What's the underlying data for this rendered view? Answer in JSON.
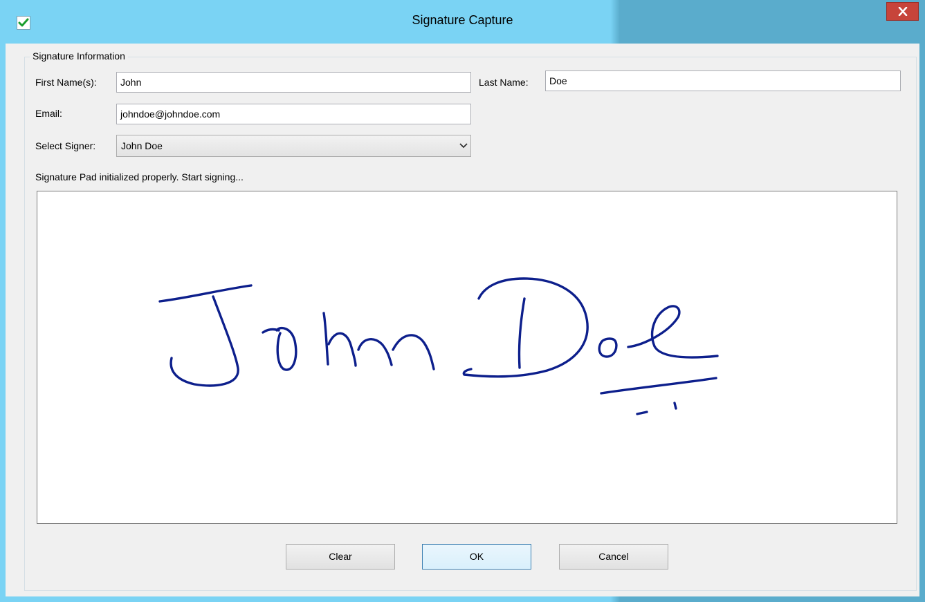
{
  "window": {
    "title": "Signature Capture",
    "icon": "check-icon",
    "close_icon": "close-icon",
    "accent_color": "#7ad3f4",
    "close_color": "#c7443a"
  },
  "group": {
    "title": "Signature Information"
  },
  "form": {
    "first_name_label": "First Name(s):",
    "first_name_value": "John",
    "last_name_label": "Last Name:",
    "last_name_value": "Doe",
    "email_label": "Email:",
    "email_value": "johndoe@johndoe.com",
    "signer_label": "Select Signer:",
    "signer_value": "John Doe"
  },
  "status": {
    "message": "Signature Pad initialized properly. Start signing..."
  },
  "signature": {
    "ink_color": "#0d1f8c"
  },
  "buttons": {
    "clear_label": "Clear",
    "ok_label": "OK",
    "cancel_label": "Cancel"
  }
}
